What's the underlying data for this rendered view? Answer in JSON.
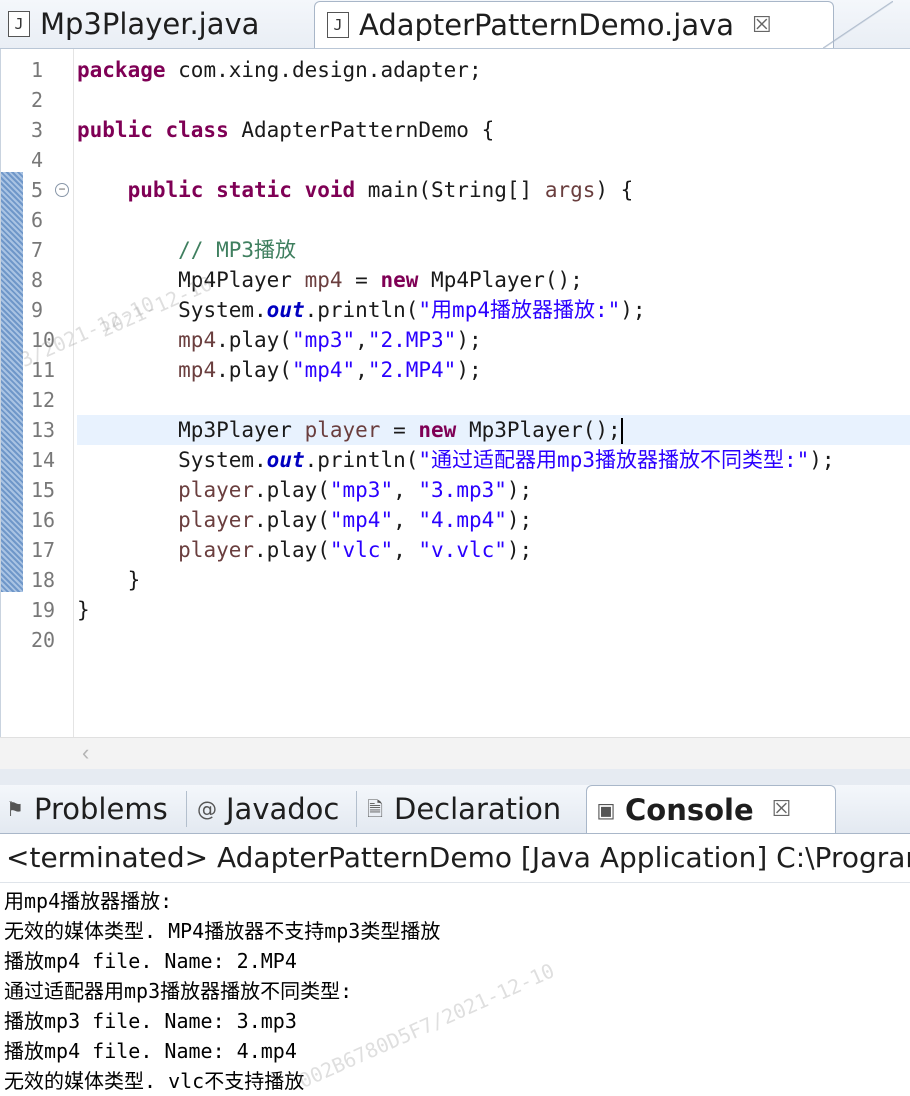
{
  "editor_tabs": [
    {
      "label": "Mp3Player.java",
      "active": false
    },
    {
      "label": "AdapterPatternDemo.java",
      "active": true,
      "close": "☒"
    }
  ],
  "code_lines": [
    {
      "n": "1"
    },
    {
      "n": "2"
    },
    {
      "n": "3"
    },
    {
      "n": "4"
    },
    {
      "n": "5"
    },
    {
      "n": "6"
    },
    {
      "n": "7"
    },
    {
      "n": "8"
    },
    {
      "n": "9"
    },
    {
      "n": "10"
    },
    {
      "n": "11"
    },
    {
      "n": "12"
    },
    {
      "n": "13"
    },
    {
      "n": "14"
    },
    {
      "n": "15"
    },
    {
      "n": "16"
    },
    {
      "n": "17"
    },
    {
      "n": "18"
    },
    {
      "n": "19"
    },
    {
      "n": "20"
    }
  ],
  "code": {
    "l1_kw": "package",
    "l1_rest": " com.xing.design.adapter;",
    "l3_kw": "public class",
    "l3_rest": " AdapterPatternDemo {",
    "l5_kw": "public static void",
    "l5_a": " main(String[] ",
    "l5_var": "args",
    "l5_b": ") {",
    "l7_cmt": "// MP3播放",
    "l8_a": "Mp4Player ",
    "l8_var": "mp4",
    "l8_b": " = ",
    "l8_kw": "new",
    "l8_c": " Mp4Player();",
    "l9_a": "System.",
    "l9_fld": "out",
    "l9_b": ".println(",
    "l9_str": "\"用mp4播放器播放:\"",
    "l9_c": ");",
    "l10_var": "mp4",
    "l10_a": ".play(",
    "l10_s1": "\"mp3\"",
    "l10_b": ",",
    "l10_s2": "\"2.MP3\"",
    "l10_c": ");",
    "l11_var": "mp4",
    "l11_a": ".play(",
    "l11_s1": "\"mp4\"",
    "l11_b": ",",
    "l11_s2": "\"2.MP4\"",
    "l11_c": ");",
    "l13_a": "Mp3Player ",
    "l13_var": "player",
    "l13_b": " = ",
    "l13_kw": "new",
    "l13_c": " Mp3Player();",
    "l14_a": "System.",
    "l14_fld": "out",
    "l14_b": ".println(",
    "l14_str": "\"通过适配器用mp3播放器播放不同类型:\"",
    "l14_c": ");",
    "l15_var": "player",
    "l15_a": ".play(",
    "l15_s1": "\"mp3\"",
    "l15_b": ", ",
    "l15_s2": "\"3.mp3\"",
    "l15_c": ");",
    "l16_var": "player",
    "l16_a": ".play(",
    "l16_s1": "\"mp4\"",
    "l16_b": ", ",
    "l16_s2": "\"4.mp4\"",
    "l16_c": ");",
    "l17_var": "player",
    "l17_a": ".play(",
    "l17_s1": "\"vlc\"",
    "l17_b": ", ",
    "l17_s2": "\"v.vlc\"",
    "l17_c": ");",
    "l18": "}",
    "l19": "}"
  },
  "fold_marker": "−",
  "hscroll_arrow": "‹",
  "view_tabs": [
    {
      "label": "Problems",
      "icon": "problems-icon",
      "glyph": "⚑"
    },
    {
      "label": "Javadoc",
      "icon": "javadoc-icon",
      "glyph": "@"
    },
    {
      "label": "Declaration",
      "icon": "declaration-icon",
      "glyph": "🗎"
    },
    {
      "label": "Console",
      "icon": "console-icon",
      "glyph": "▣",
      "active": true,
      "close": "☒"
    }
  ],
  "console_header": "<terminated> AdapterPatternDemo [Java Application] C:\\Program F",
  "console_output": [
    "用mp4播放器播放:",
    "无效的媒体类型. MP4播放器不支持mp3类型播放",
    "播放mp4 file. Name: 2.MP4",
    "通过适配器用mp3播放器播放不同类型:",
    "播放mp3 file. Name: 3.mp3",
    "播放mp4 file. Name: 4.mp4",
    "无效的媒体类型. vlc不支持播放"
  ],
  "watermarks": {
    "w1": "2021-12-10",
    "w2": "3/2021-12-10",
    "w3": "002B6780D5F7/2021-12-10"
  }
}
